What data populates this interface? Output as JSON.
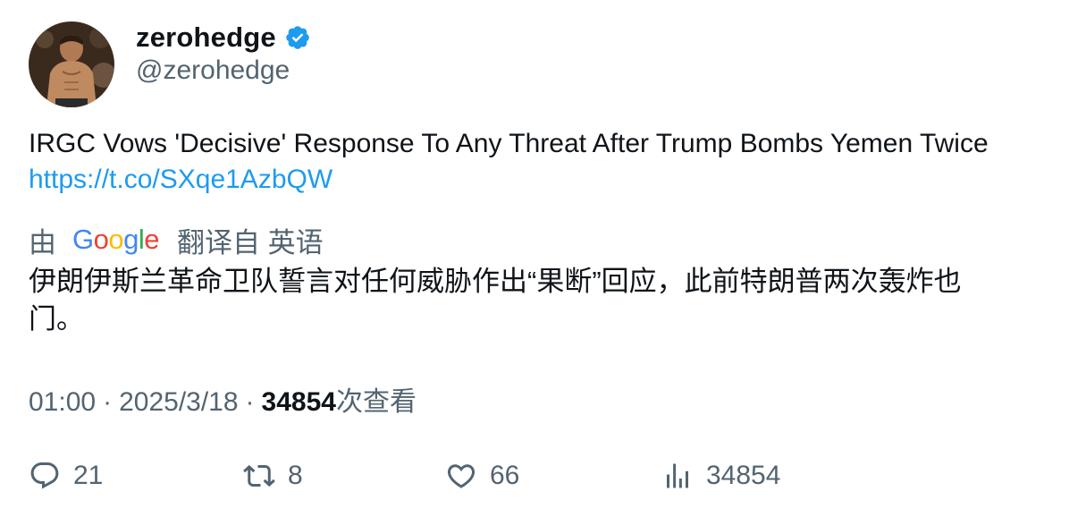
{
  "author": {
    "display_name": "zerohedge",
    "handle": "@zerohedge",
    "verified_icon": "verified-badge-icon",
    "verified_color": "#1d9bf0"
  },
  "tweet": {
    "text": "IRGC Vows 'Decisive' Response To Any Threat After Trump Bombs Yemen Twice ",
    "link": "https://t.co/SXqe1AzbQW",
    "link_color": "#1d9bf0"
  },
  "translation": {
    "by": "由",
    "provider": "Google",
    "from_label": "翻译自 英语",
    "text": "伊朗伊斯兰革命卫队誓言对任何威胁作出“果断”回应，此前特朗普两次轰炸也门。"
  },
  "meta": {
    "time": "01:00",
    "separator": "·",
    "date": "2025/3/18",
    "views_count": "34854",
    "views_label": "次查看"
  },
  "actions": {
    "reply_count": "21",
    "retweet_count": "8",
    "like_count": "66",
    "views_count": "34854"
  }
}
